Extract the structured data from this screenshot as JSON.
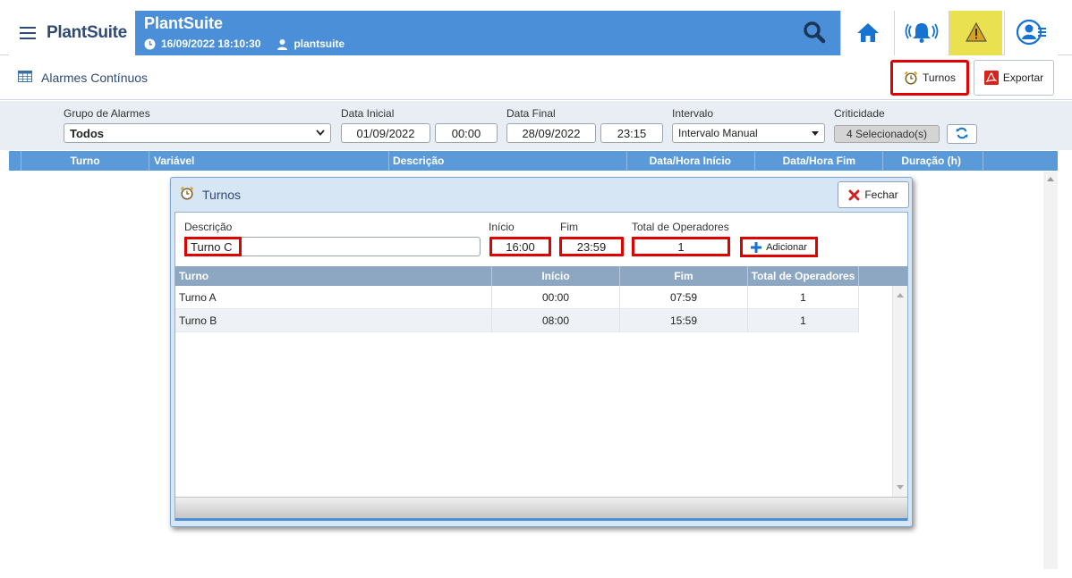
{
  "header": {
    "brand": "PlantSuite",
    "app_title": "PlantSuite",
    "datetime": "16/09/2022 18:10:30",
    "user": "plantsuite",
    "warning_color": "#e9e14f",
    "accent_color": "#4a8fd8"
  },
  "page": {
    "title": "Alarmes Contínuos",
    "turnos_label": "Turnos",
    "exportar_label": "Exportar"
  },
  "filters": {
    "grupo_label": "Grupo de Alarmes",
    "grupo_value": "Todos",
    "data_inicial_label": "Data Inicial",
    "data_inicial_value": "01/09/2022",
    "hora_inicial_value": "00:00",
    "data_final_label": "Data Final",
    "data_final_value": "28/09/2022",
    "hora_final_value": "23:15",
    "intervalo_label": "Intervalo",
    "intervalo_value": "Intervalo Manual",
    "criticidade_label": "Criticidade",
    "criticidade_value": "4 Selecionado(s)"
  },
  "grid": {
    "columns": [
      "Turno",
      "Variável",
      "Descrição",
      "Data/Hora Início",
      "Data/Hora Fim",
      "Duração (h)"
    ]
  },
  "dialog": {
    "title": "Turnos",
    "close_label": "Fechar",
    "descricao_label": "Descrição",
    "descricao_value": "Turno C",
    "inicio_label": "Início",
    "inicio_value": "16:00",
    "fim_label": "Fim",
    "fim_value": "23:59",
    "total_label": "Total de Operadores",
    "total_value": "1",
    "add_label": "Adicionar",
    "columns": [
      "Turno",
      "Início",
      "Fim",
      "Total de Operadores"
    ],
    "rows": [
      [
        "Turno A",
        "00:00",
        "07:59",
        "1"
      ],
      [
        "Turno B",
        "08:00",
        "15:59",
        "1"
      ]
    ]
  }
}
